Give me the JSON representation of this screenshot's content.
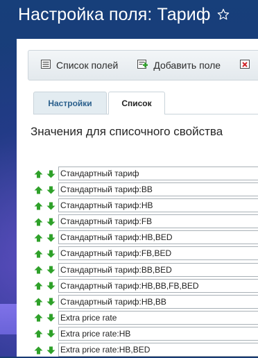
{
  "page": {
    "title": "Настройка поля: Тариф"
  },
  "toolbar": {
    "fields_list_label": "Список полей",
    "add_field_label": "Добавить поле"
  },
  "tabs": [
    {
      "label": "Настройки",
      "active": false
    },
    {
      "label": "Список",
      "active": true
    }
  ],
  "section": {
    "title": "Значения для списочного свойства"
  },
  "values": [
    "Стандартный тариф",
    "Стандартный тариф:BB",
    "Стандартный тариф:HB",
    "Стандартный тариф:FB",
    "Стандартный тариф:HB,BED",
    "Стандартный тариф:FB,BED",
    "Стандартный тариф:BB,BED",
    "Стандартный тариф:HB,BB,FB,BED",
    "Стандартный тариф:HB,BB",
    "Extra price rate",
    "Extra price rate:HB",
    "Extra price rate:HB,BED"
  ],
  "colors": {
    "arrow_green": "#2fa12a",
    "tab_active_text": "#222222",
    "tab_inactive_text": "#2a5f8c"
  },
  "icons": {
    "star": "star-outline-icon",
    "fields_list": "list-icon",
    "add_field": "add-field-icon",
    "delete": "delete-icon",
    "move_up": "arrow-up-icon",
    "move_down": "arrow-down-icon"
  }
}
